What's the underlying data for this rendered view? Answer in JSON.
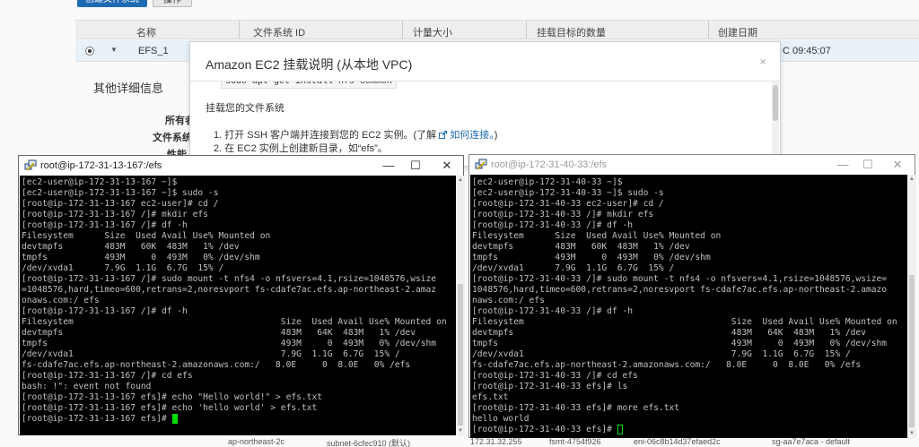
{
  "console": {
    "create_button": "创建文件系统",
    "actions_button": "操作",
    "columns": [
      "名称",
      "文件系统 ID",
      "计量大小",
      "挂载目标的数量",
      "创建日期"
    ],
    "row": {
      "name": "EFS_1",
      "date": "C 09:45:07"
    },
    "details_title": "其他详细信息",
    "detail_labels": [
      "所有者",
      "文件系统",
      "性能"
    ],
    "bottom_row": [
      "ap-northeast-2c",
      "subnet-6cfec910 (默认)",
      "172.31.32.255",
      "fsmt-4754f926",
      "eni-06c8b14d37efaed2c",
      "sg-aa7e7aca - default"
    ]
  },
  "modal": {
    "title": "Amazon EC2 挂载说明 (从本地 VPC)",
    "close": "×",
    "code_snippet": "sudo apt-get install nfs-common",
    "heading": "挂载您的文件系统",
    "step1": "1. 打开 SSH 客户端并连接到您的 EC2 实例。(了解",
    "step1_link": "如何连接。",
    "step1_end": ")",
    "step2": "2. 在 EC2 实例上创建新目录，如“efs”。"
  },
  "terminal_left": {
    "title": "root@ip-172-31-13-167:/efs",
    "controls": {
      "minimize": "—",
      "maximize": "☐",
      "close": "✕"
    },
    "lines": [
      "[ec2-user@ip-172-31-13-167 ~]$",
      "[ec2-user@ip-172-31-13-167 ~]$ sudo -s",
      "[root@ip-172-31-13-167 ec2-user]# cd /",
      "[root@ip-172-31-13-167 /]# mkdir efs",
      "[root@ip-172-31-13-167 /]# df -h",
      "Filesystem      Size  Used Avail Use% Mounted on",
      "devtmpfs        483M   60K  483M   1% /dev",
      "tmpfs           493M     0  493M   0% /dev/shm",
      "/dev/xvda1      7.9G  1.1G  6.7G  15% /",
      "[root@ip-172-31-13-167 /]# sudo mount -t nfs4 -o nfsvers=4.1,rsize=1048576,wsize",
      "=1048576,hard,timeo=600,retrans=2,noresvport fs-cdafe7ac.efs.ap-northeast-2.amaz",
      "onaws.com:/ efs",
      "[root@ip-172-31-13-167 /]# df -h",
      "Filesystem                                        Size  Used Avail Use% Mounted on",
      "devtmpfs                                          483M   64K  483M   1% /dev",
      "tmpfs                                             493M     0  493M   0% /dev/shm",
      "/dev/xvda1                                        7.9G  1.1G  6.7G  15% /",
      "fs-cdafe7ac.efs.ap-northeast-2.amazonaws.com:/   8.0E     0  8.0E   0% /efs",
      "[root@ip-172-31-13-167 /]# cd efs",
      "bash: !\": event not found",
      "[root@ip-172-31-13-167 efs]# echo \"Hello world!\" > efs.txt",
      "[root@ip-172-31-13-167 efs]# echo 'hello world' > efs.txt",
      "[root@ip-172-31-13-167 efs]# "
    ]
  },
  "terminal_right": {
    "title": "root@ip-172-31-40-33:/efs",
    "controls": {
      "minimize": "—",
      "maximize": "☐",
      "close": "✕"
    },
    "lines": [
      "[ec2-user@ip-172-31-40-33 ~]$",
      "[ec2-user@ip-172-31-40-33 ~]$ sudo -s",
      "[root@ip-172-31-40-33 ec2-user]# cd /",
      "[root@ip-172-31-40-33 /]# mkdir efs",
      "[root@ip-172-31-40-33 /]# df -h",
      "Filesystem      Size  Used Avail Use% Mounted on",
      "devtmpfs        483M   60K  483M   1% /dev",
      "tmpfs           493M     0  493M   0% /dev/shm",
      "/dev/xvda1      7.9G  1.1G  6.7G  15% /",
      "[root@ip-172-31-40-33 /]# sudo mount -t nfs4 -o nfsvers=4.1,rsize=1048576,wsize=",
      "1048576,hard,timeo=600,retrans=2,noresvport fs-cdafe7ac.efs.ap-northeast-2.amazo",
      "naws.com:/ efs",
      "[root@ip-172-31-40-33 /]# df -h",
      "Filesystem                                        Size  Used Avail Use% Mounted on",
      "devtmpfs                                          483M   64K  483M   1% /dev",
      "tmpfs                                             493M     0  493M   0% /dev/shm",
      "/dev/xvda1                                        7.9G  1.1G  6.7G  15% /",
      "fs-cdafe7ac.efs.ap-northeast-2.amazonaws.com:/   8.0E     0  8.0E   0% /efs",
      "[root@ip-172-31-40-33 /]# cd efs",
      "[root@ip-172-31-40-33 efs]# ls",
      "efs.txt",
      "[root@ip-172-31-40-33 efs]# more efs.txt",
      "hello world",
      "[root@ip-172-31-40-33 efs]# "
    ]
  }
}
